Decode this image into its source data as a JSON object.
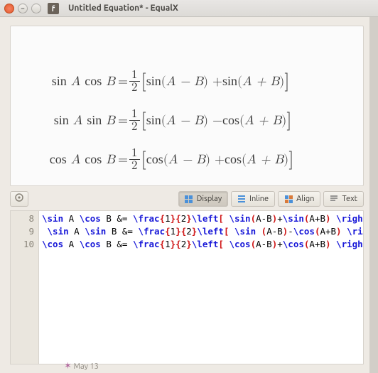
{
  "window": {
    "title": "Untitled Equation* - EqualX"
  },
  "equations": [
    {
      "lhs_a": "sin",
      "lhs_b": "cos",
      "r1fn": "sin",
      "r1arg": "A − B",
      "op": "+",
      "r2fn": "sin",
      "r2arg": "A + B"
    },
    {
      "lhs_a": "sin",
      "lhs_b": "sin",
      "r1fn": "sin",
      "r1arg": "A − B",
      "op": "−",
      "r2fn": "cos",
      "r2arg": "A + B"
    },
    {
      "lhs_a": "cos",
      "lhs_b": "cos",
      "r1fn": "cos",
      "r1arg": "A − B",
      "op": "+",
      "r2fn": "cos",
      "r2arg": "A + B"
    }
  ],
  "toolbar": {
    "display": "Display",
    "inline": "Inline",
    "align": "Align",
    "text": "Text"
  },
  "code": {
    "lines": [
      {
        "num": "8",
        "tokens": [
          {
            "c": "kw",
            "t": "\\sin"
          },
          {
            "c": "txt",
            "t": " A "
          },
          {
            "c": "kw",
            "t": "\\cos"
          },
          {
            "c": "txt",
            "t": " B &= "
          },
          {
            "c": "kw",
            "t": "\\frac"
          },
          {
            "c": "br",
            "t": "{"
          },
          {
            "c": "txt",
            "t": "1"
          },
          {
            "c": "br",
            "t": "}{"
          },
          {
            "c": "txt",
            "t": "2"
          },
          {
            "c": "br",
            "t": "}"
          },
          {
            "c": "kw",
            "t": "\\left"
          },
          {
            "c": "br",
            "t": "["
          },
          {
            "c": "txt",
            "t": " "
          },
          {
            "c": "kw",
            "t": "\\sin"
          },
          {
            "c": "br",
            "t": "("
          },
          {
            "c": "txt",
            "t": "A-B"
          },
          {
            "c": "br",
            "t": ")"
          },
          {
            "c": "txt",
            "t": "+"
          },
          {
            "c": "kw",
            "t": "\\sin"
          },
          {
            "c": "br",
            "t": "("
          },
          {
            "c": "txt",
            "t": "A+B"
          },
          {
            "c": "br",
            "t": ")"
          },
          {
            "c": "txt",
            "t": " "
          },
          {
            "c": "kw",
            "t": "\\right"
          },
          {
            "c": "br",
            "t": "]"
          },
          {
            "c": "txt",
            "t": " "
          },
          {
            "c": "kw",
            "t": "\\\\"
          }
        ]
      },
      {
        "num": "9",
        "tokens": [
          {
            "c": "txt",
            "t": " "
          },
          {
            "c": "kw",
            "t": "\\sin"
          },
          {
            "c": "txt",
            "t": " A "
          },
          {
            "c": "kw",
            "t": "\\sin"
          },
          {
            "c": "txt",
            "t": " B &= "
          },
          {
            "c": "kw",
            "t": "\\frac"
          },
          {
            "c": "br",
            "t": "{"
          },
          {
            "c": "txt",
            "t": "1"
          },
          {
            "c": "br",
            "t": "}{"
          },
          {
            "c": "txt",
            "t": "2"
          },
          {
            "c": "br",
            "t": "}"
          },
          {
            "c": "kw",
            "t": "\\left"
          },
          {
            "c": "br",
            "t": "["
          },
          {
            "c": "txt",
            "t": " "
          },
          {
            "c": "kw",
            "t": "\\sin"
          },
          {
            "c": "txt",
            "t": " "
          },
          {
            "c": "br",
            "t": "("
          },
          {
            "c": "txt",
            "t": "A-B"
          },
          {
            "c": "br",
            "t": ")"
          },
          {
            "c": "txt",
            "t": "-"
          },
          {
            "c": "kw",
            "t": "\\cos"
          },
          {
            "c": "br",
            "t": "("
          },
          {
            "c": "txt",
            "t": "A+B"
          },
          {
            "c": "br",
            "t": ")"
          },
          {
            "c": "txt",
            "t": " "
          },
          {
            "c": "kw",
            "t": "\\right"
          },
          {
            "c": "br",
            "t": "]"
          },
          {
            "c": "txt",
            "t": " "
          },
          {
            "c": "kw",
            "t": "\\\\"
          }
        ]
      },
      {
        "num": "10",
        "tokens": [
          {
            "c": "kw",
            "t": "\\cos"
          },
          {
            "c": "txt",
            "t": " A "
          },
          {
            "c": "kw",
            "t": "\\cos"
          },
          {
            "c": "txt",
            "t": " B &= "
          },
          {
            "c": "kw",
            "t": "\\frac"
          },
          {
            "c": "br",
            "t": "{"
          },
          {
            "c": "txt",
            "t": "1"
          },
          {
            "c": "br",
            "t": "}{"
          },
          {
            "c": "txt",
            "t": "2"
          },
          {
            "c": "br",
            "t": "}"
          },
          {
            "c": "kw",
            "t": "\\left"
          },
          {
            "c": "br",
            "t": "["
          },
          {
            "c": "txt",
            "t": " "
          },
          {
            "c": "kw",
            "t": "\\cos"
          },
          {
            "c": "br",
            "t": "("
          },
          {
            "c": "txt",
            "t": "A-B"
          },
          {
            "c": "br",
            "t": ")"
          },
          {
            "c": "txt",
            "t": "+"
          },
          {
            "c": "kw",
            "t": "\\cos"
          },
          {
            "c": "br",
            "t": "("
          },
          {
            "c": "txt",
            "t": "A+B"
          },
          {
            "c": "br",
            "t": ")"
          },
          {
            "c": "txt",
            "t": " "
          },
          {
            "c": "kw",
            "t": "\\right"
          },
          {
            "c": "br",
            "t": "]"
          }
        ]
      }
    ]
  },
  "footer": "May 13"
}
